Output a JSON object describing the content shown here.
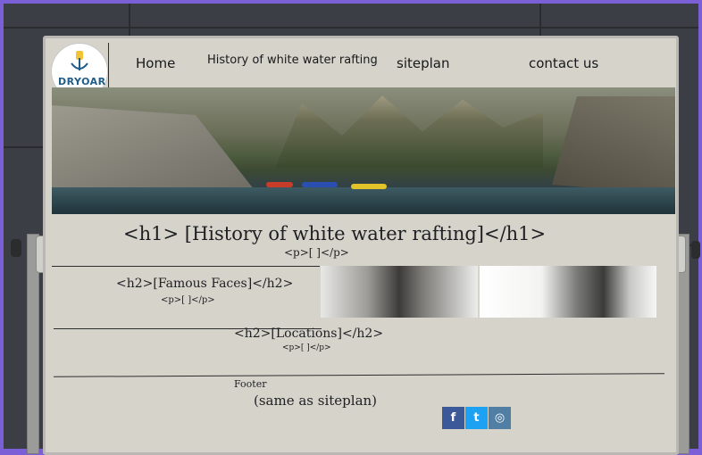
{
  "nav": {
    "logo_text": "DRYOAR",
    "links": [
      "Home",
      "History of white water rafting",
      "siteplan",
      "contact us"
    ]
  },
  "content": {
    "h1": "<h1> [History of white water rafting]</h1>",
    "h1_p": "<p>[    ]</p>",
    "famous": "<h2>[Famous Faces]</h2>",
    "famous_p": "<p>[      ]</p>",
    "locations": "<h2>[Locations]</h2>",
    "locations_p": "<p>[     ]</p>",
    "footer_label": "Footer",
    "footer_note": "(same as siteplan)"
  },
  "social": [
    {
      "icon": "facebook-icon",
      "glyph": "f",
      "color": "#3b5998"
    },
    {
      "icon": "twitter-icon",
      "glyph": "t",
      "color": "#1da1f2"
    },
    {
      "icon": "instagram-icon",
      "glyph": "◎",
      "color": "#517fa4"
    }
  ]
}
